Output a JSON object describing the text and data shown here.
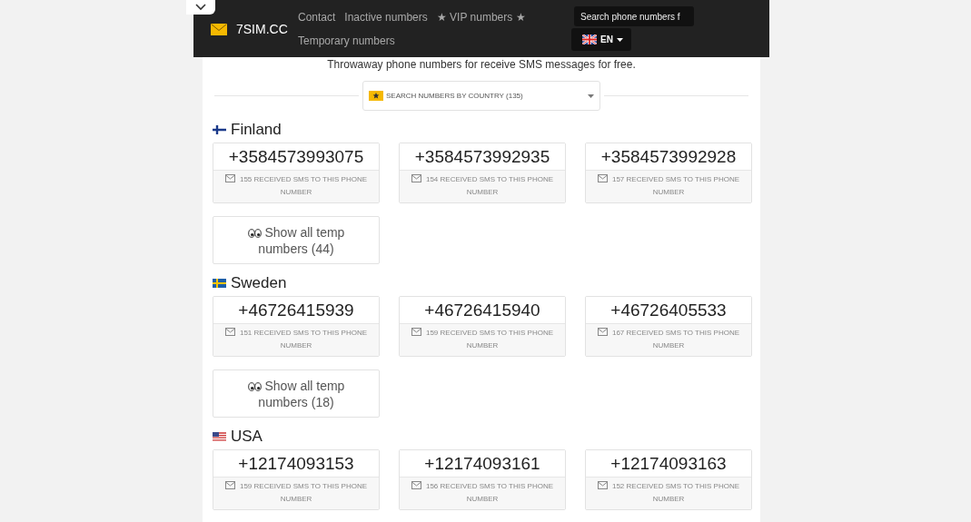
{
  "header": {
    "brand": "7SIM.CC",
    "nav": [
      {
        "label": "Contact"
      },
      {
        "label": "Inactive numbers"
      },
      {
        "label": "★ VIP numbers ★"
      },
      {
        "label": "Temporary numbers"
      }
    ],
    "search": {
      "placeholder": "Search phone numbers f"
    },
    "language": {
      "label": "EN"
    }
  },
  "tagline": "Throwaway phone numbers for receive SMS messages for free.",
  "country_select": {
    "label": "SEARCH NUMBERS BY COUNTRY (135)"
  },
  "countries": [
    {
      "name": "Finland",
      "kind": "fi",
      "numbers": [
        {
          "number": "+3584573993075",
          "info": "155 RECEIVED SMS TO THIS PHONE NUMBER"
        },
        {
          "number": "+3584573992935",
          "info": "154 RECEIVED SMS TO THIS PHONE NUMBER"
        },
        {
          "number": "+3584573992928",
          "info": "157 RECEIVED SMS TO THIS PHONE NUMBER"
        }
      ],
      "show_all": "Show all temp numbers (44)"
    },
    {
      "name": "Sweden",
      "kind": "se",
      "numbers": [
        {
          "number": "+46726415939",
          "info": "151 RECEIVED SMS TO THIS PHONE NUMBER"
        },
        {
          "number": "+46726415940",
          "info": "159 RECEIVED SMS TO THIS PHONE NUMBER"
        },
        {
          "number": "+46726405533",
          "info": "167 RECEIVED SMS TO THIS PHONE NUMBER"
        }
      ],
      "show_all": "Show all temp numbers (18)"
    },
    {
      "name": "USA",
      "kind": "us",
      "numbers": [
        {
          "number": "+12174093153",
          "info": "159 RECEIVED SMS TO THIS PHONE NUMBER"
        },
        {
          "number": "+12174093161",
          "info": "156 RECEIVED SMS TO THIS PHONE NUMBER"
        },
        {
          "number": "+12174093163",
          "info": "152 RECEIVED SMS TO THIS PHONE NUMBER"
        }
      ]
    }
  ]
}
